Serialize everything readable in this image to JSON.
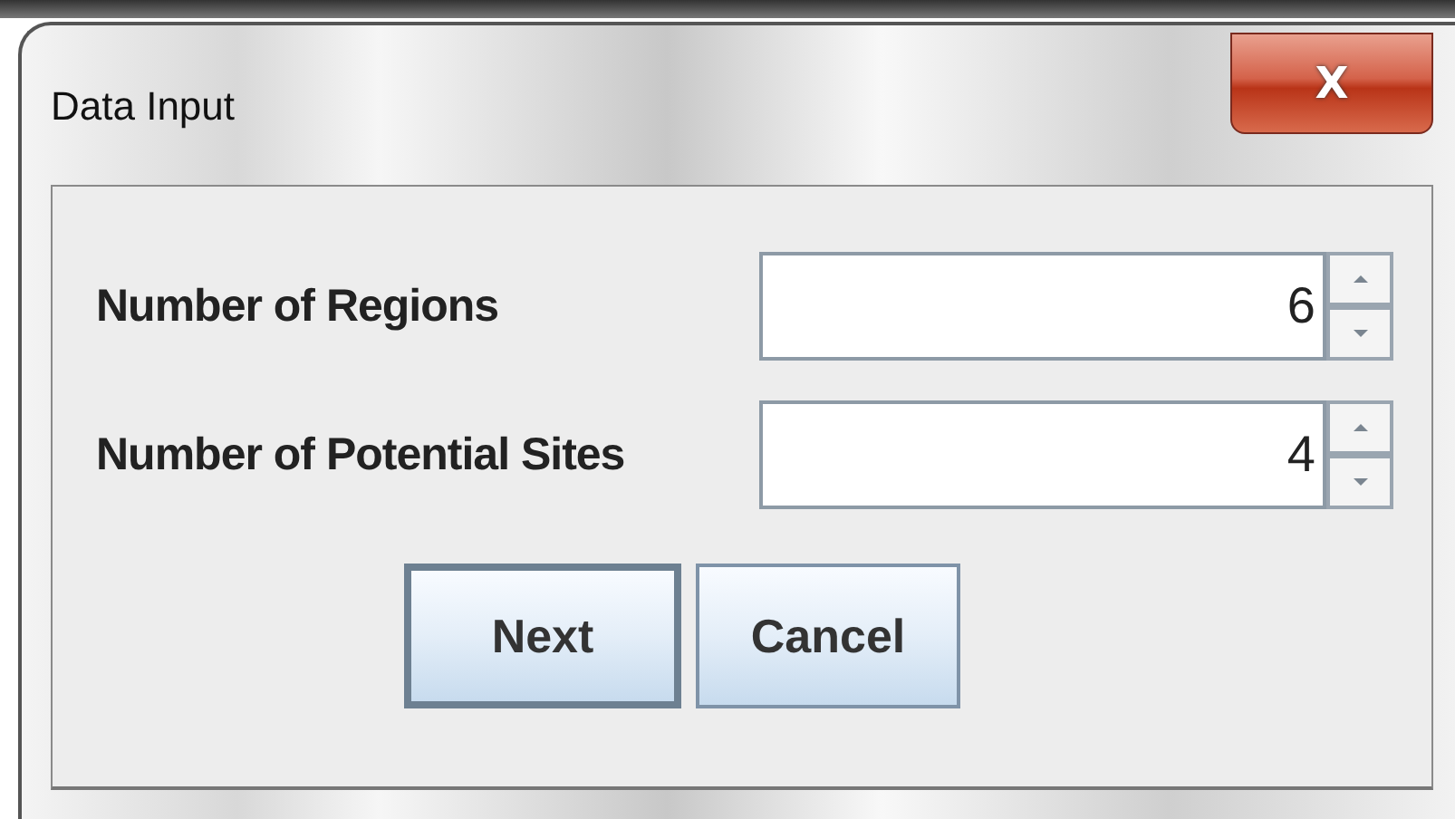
{
  "window": {
    "title": "Data Input",
    "close_label": "X"
  },
  "fields": [
    {
      "label": "Number of Regions",
      "value": "6"
    },
    {
      "label": "Number of Potential Sites",
      "value": "4"
    }
  ],
  "buttons": [
    {
      "label": "Next",
      "default": true
    },
    {
      "label": "Cancel",
      "default": false
    }
  ]
}
